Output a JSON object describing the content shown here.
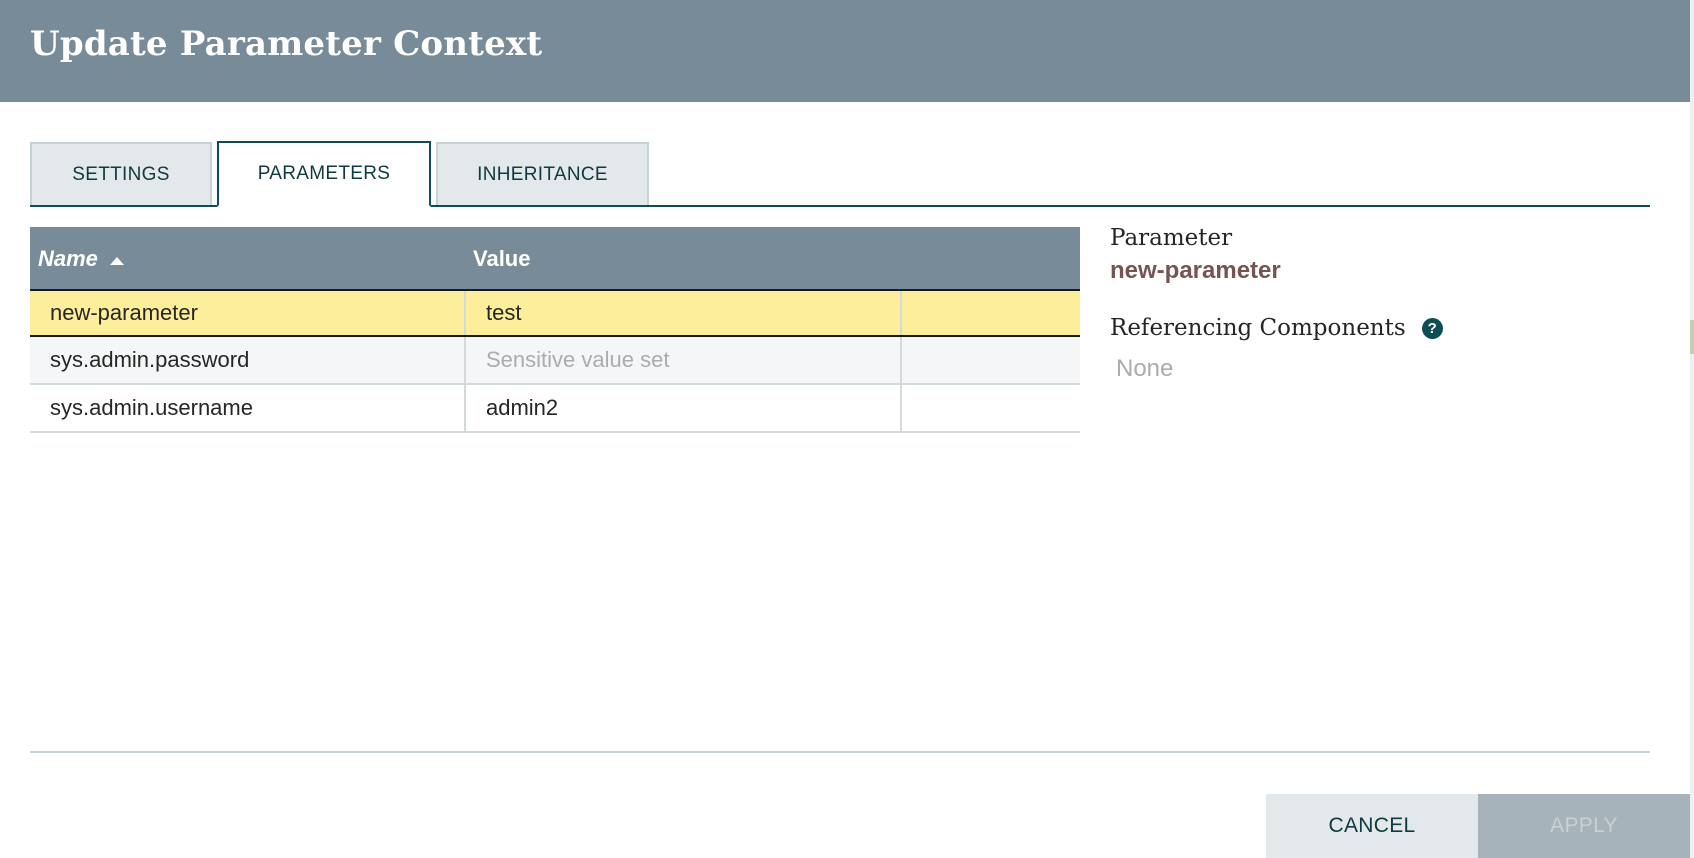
{
  "dialog": {
    "title": "Update Parameter Context"
  },
  "tabs": [
    {
      "label": "SETTINGS",
      "active": false
    },
    {
      "label": "PARAMETERS",
      "active": true
    },
    {
      "label": "INHERITANCE",
      "active": false
    }
  ],
  "table": {
    "columns": {
      "name": "Name",
      "value": "Value"
    },
    "sort": {
      "column": "Name",
      "direction": "ascending"
    },
    "rows": [
      {
        "name": "new-parameter",
        "value": "test",
        "selected": true,
        "sensitive": false
      },
      {
        "name": "sys.admin.password",
        "value": "Sensitive value set",
        "selected": false,
        "sensitive": true
      },
      {
        "name": "sys.admin.username",
        "value": "admin2",
        "selected": false,
        "sensitive": false
      }
    ]
  },
  "details": {
    "parameter_label": "Parameter",
    "parameter_name": "new-parameter",
    "referencing_label": "Referencing Components",
    "referencing_value": "None",
    "help_icon": "question-circle-icon"
  },
  "footer": {
    "cancel_label": "CANCEL",
    "apply_label": "APPLY",
    "apply_enabled": false
  },
  "colors": {
    "header_bg": "#778c98",
    "accent": "#0f4d55",
    "selected_row": "#fcee9a",
    "parameter_name": "#775351"
  }
}
